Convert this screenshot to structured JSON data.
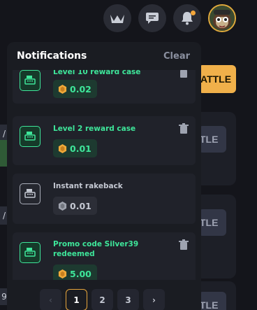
{
  "topbar": {
    "icons": [
      "crown-icon",
      "chat-icon",
      "bell-icon"
    ],
    "has_notification_dot": true
  },
  "background": {
    "battle_label": "ATTLE",
    "card_button_label": "TLE",
    "left_strip_labels": [
      "/",
      "/",
      "9"
    ]
  },
  "notifications": {
    "title": "Notifications",
    "clear_label": "Clear",
    "items": [
      {
        "title": "Level 10 reward case",
        "amount": "0.02",
        "style": "green"
      },
      {
        "title": "Level 2 reward case",
        "amount": "0.01",
        "style": "green"
      },
      {
        "title": "Instant rakeback",
        "amount": "0.01",
        "style": "gray"
      },
      {
        "title": "Promo code Silver39 redeemed",
        "amount": "5.00",
        "style": "green"
      }
    ]
  },
  "pagination": {
    "prev": "‹",
    "pages": [
      "1",
      "2",
      "3"
    ],
    "active_page": "1",
    "next": "›"
  },
  "colors": {
    "accent_gold": "#f0b04a",
    "accent_green": "#3ee69a",
    "panel_bg": "#1a1c22"
  }
}
